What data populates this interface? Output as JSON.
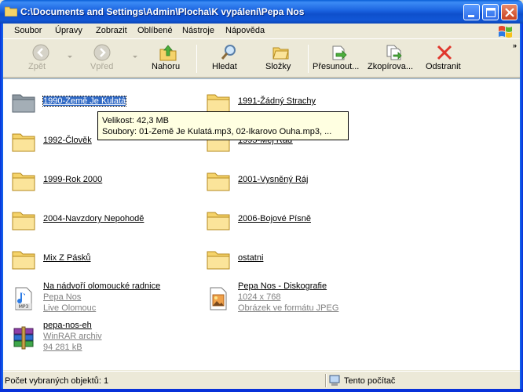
{
  "window": {
    "title": "C:\\Documents and Settings\\Admin\\Plocha\\K vypálení\\Pepa Nos"
  },
  "menu": [
    "Soubor",
    "Úpravy",
    "Zobrazit",
    "Oblíbené",
    "Nástroje",
    "Nápověda"
  ],
  "toolbar": {
    "back": "Zpět",
    "forward": "Vpřed",
    "up": "Nahoru",
    "search": "Hledat",
    "folders": "Složky",
    "move": "Přesunout...",
    "copy": "Zkopírova...",
    "delete": "Odstranit",
    "more": "»"
  },
  "items": [
    {
      "name": "1990-Země Je Kulatá",
      "type": "folder"
    },
    {
      "name": "1991-Žádný Strachy",
      "type": "folder"
    },
    {
      "name": "1992-Člověk",
      "type": "folder"
    },
    {
      "name": "1995-Mej Ráď",
      "type": "folder"
    },
    {
      "name": "1999-Rok 2000",
      "type": "folder"
    },
    {
      "name": "2001-Vysněný Ráj",
      "type": "folder"
    },
    {
      "name": "2004-Navzdory Nepohodě",
      "type": "folder"
    },
    {
      "name": "2006-Bojové Písně",
      "type": "folder"
    },
    {
      "name": "Mix Z Pásků",
      "type": "folder"
    },
    {
      "name": "ostatni",
      "type": "folder"
    },
    {
      "name": "Na nádvoří olomoucké radnice",
      "type": "mp3",
      "meta": [
        "Pepa Nos",
        "Live Olomouc"
      ]
    },
    {
      "name": "Pepa Nos - Diskografie",
      "type": "jpeg",
      "meta": [
        "1024 x 768",
        "Obrázek ve formátu JPEG"
      ]
    },
    {
      "name": "pepa-nos-eh",
      "type": "rar",
      "meta": [
        "WinRAR archiv",
        "94 281 kB"
      ]
    }
  ],
  "tooltip": {
    "size": "Velikost: 42,3 MB",
    "files": "Soubory: 01-Země Je Kulatá.mp3, 02-Ikarovo Ouha.mp3, ..."
  },
  "status": {
    "left": "Počet vybraných objektů: 1",
    "right": "Tento počítač"
  },
  "colors": {
    "titlebar": "#0E4FCC",
    "selection": "#316AC5",
    "folder": "#F5D36A",
    "tooltip_bg": "#FFFFE1"
  }
}
